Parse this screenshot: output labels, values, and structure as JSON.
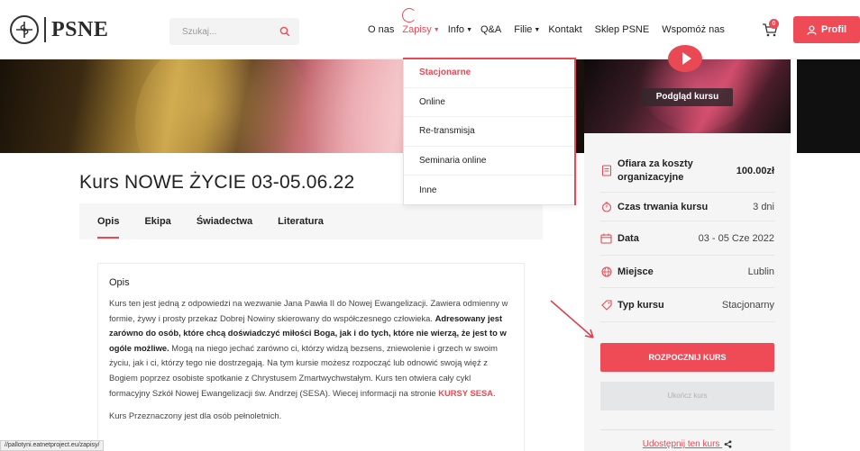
{
  "header": {
    "logo_text": "PSNE",
    "search_placeholder": "Szukaj...",
    "nav": [
      {
        "label": "O nas",
        "dropdown": false
      },
      {
        "label": "Zapisy",
        "dropdown": true,
        "active": true
      },
      {
        "label": "Info",
        "dropdown": true
      },
      {
        "label": "Q&A",
        "dropdown": false
      },
      {
        "label": "Filie",
        "dropdown": true
      },
      {
        "label": "Kontakt",
        "dropdown": false
      },
      {
        "label": "Sklep PSNE",
        "dropdown": false
      },
      {
        "label": "Wspomóż nas",
        "dropdown": false
      }
    ],
    "cart_count": "0",
    "profile_label": "Profil"
  },
  "dropdown": {
    "items": [
      "Stacjonarne",
      "Online",
      "Re-transmisja",
      "Seminaria online",
      "Inne"
    ]
  },
  "preview": {
    "label": "Podgląd kursu"
  },
  "course": {
    "title": "Kurs NOWE ŻYCIE 03-05.06.22",
    "tabs": [
      "Opis",
      "Ekipa",
      "Świadectwa",
      "Literatura"
    ],
    "desc_heading": "Opis",
    "desc_part1": "Kurs ten jest jedną z odpowiedzi na wezwanie Jana Pawła II do Nowej Ewangelizacji. Zawiera odmienny w formie, żywy i prosty przekaz Dobrej Nowiny skierowany do współczesnego człowieka. ",
    "desc_bold": "Adresowany jest zarówno do osób, które chcą doświadczyć miłości Boga, jak i do tych, które nie wierzą, że jest to w ogóle możliwe.",
    "desc_part2": " Mogą na niego jechać zarówno ci, którzy widzą bezsens, zniewolenie i grzech w swoim życiu, jak i ci, którzy tego nie dostrzegają. Na tym kursie możesz rozpocząć lub odnowić swoją więź z Bogiem poprzez osobiste spotkanie z Chrystusem Zmartwychwstałym. Kurs ten otwiera cały cykl formacyjny Szkół Nowej Ewangelizacji św. Andrzej (SESA). Wiecej informacji na stronie ",
    "desc_link": "KURSY SESA",
    "desc_part3": ".",
    "desc_extra": "Kurs Przeznaczony jest dla osób pełnoletnich."
  },
  "sidebar": {
    "rows": [
      {
        "label": "Ofiara za koszty organizacyjne",
        "value": "100.00zł"
      },
      {
        "label": "Czas trwania kursu",
        "value": "3 dni"
      },
      {
        "label": "Data",
        "value": "03 - 05 Cze 2022"
      },
      {
        "label": "Miejsce",
        "value": "Lublin"
      },
      {
        "label": "Typ kursu",
        "value": "Stacjonarny"
      }
    ],
    "start_button": "ROZPOCZNIJ KURS",
    "finish_button": "Ukończ kurs",
    "share_label": "Udostępnij ten kurs"
  },
  "statusbar": {
    "url": "//pallotyni.eatnetproject.eu/zapisy/"
  },
  "colors": {
    "accent": "#e84955",
    "button": "#ef4b57"
  }
}
